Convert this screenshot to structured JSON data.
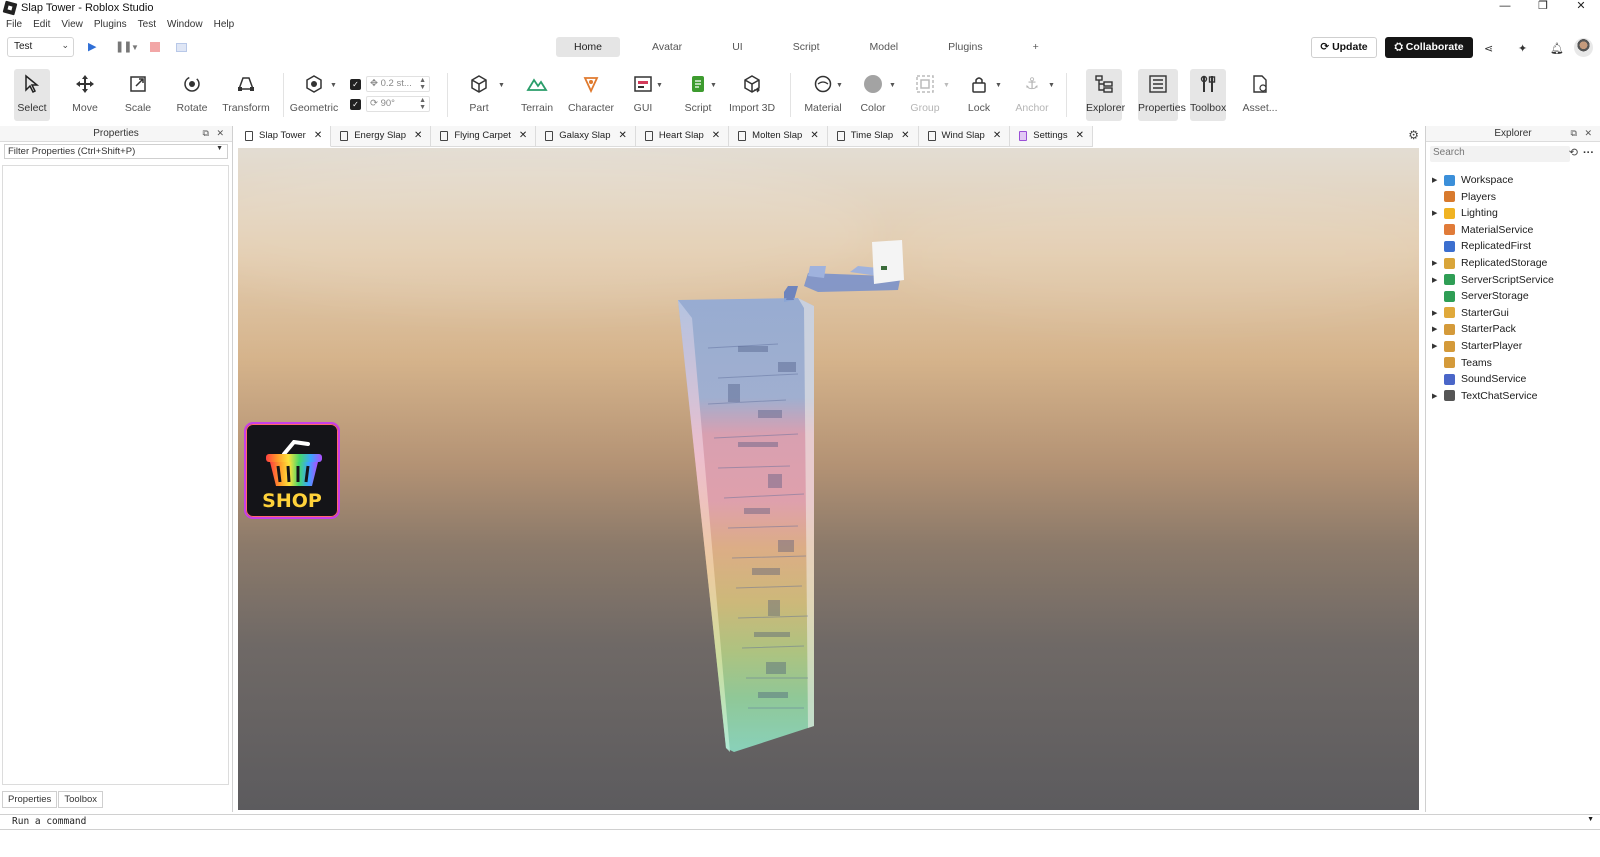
{
  "window": {
    "title": "Slap Tower - Roblox Studio",
    "controls": [
      "—",
      "❐",
      "✕"
    ]
  },
  "menu": [
    "File",
    "Edit",
    "View",
    "Plugins",
    "Test",
    "Window",
    "Help"
  ],
  "nav": {
    "mode_select": "Test",
    "tabs": [
      "Home",
      "Avatar",
      "UI",
      "Script",
      "Model",
      "Plugins",
      "+"
    ],
    "active_tab": "Home",
    "update_label": "Update",
    "collaborate_label": "Collaborate"
  },
  "ribbon": {
    "select": "Select",
    "move": "Move",
    "scale": "Scale",
    "rotate": "Rotate",
    "transform": "Transform",
    "geometric": "Geometric",
    "move_step": "0.2 st...",
    "rotate_step": "90°",
    "part": "Part",
    "terrain": "Terrain",
    "character": "Character",
    "gui": "GUI",
    "script": "Script",
    "import3d": "Import 3D",
    "material": "Material",
    "color": "Color",
    "group": "Group",
    "lock": "Lock",
    "anchor": "Anchor",
    "explorer": "Explorer",
    "properties": "Properties",
    "toolbox": "Toolbox",
    "asset": "Asset..."
  },
  "properties_panel": {
    "title": "Properties",
    "filter_placeholder": "Filter Properties (Ctrl+Shift+P)",
    "bottom_tabs": [
      "Properties",
      "Toolbox"
    ]
  },
  "doc_tabs": [
    "Slap Tower",
    "Energy Slap",
    "Flying Carpet",
    "Galaxy Slap",
    "Heart Slap",
    "Molten Slap",
    "Time Slap",
    "Wind Slap",
    "Settings"
  ],
  "viewport": {
    "shop_label": "SHOP"
  },
  "explorer": {
    "title": "Explorer",
    "search_placeholder": "Search",
    "items": [
      {
        "label": "Workspace",
        "expandable": true,
        "color": "#3b8fd9"
      },
      {
        "label": "Players",
        "expandable": false,
        "color": "#d87a2e"
      },
      {
        "label": "Lighting",
        "expandable": true,
        "color": "#f0b323"
      },
      {
        "label": "MaterialService",
        "expandable": false,
        "color": "#e07b39"
      },
      {
        "label": "ReplicatedFirst",
        "expandable": false,
        "color": "#3c6fcf"
      },
      {
        "label": "ReplicatedStorage",
        "expandable": true,
        "color": "#d9a53a"
      },
      {
        "label": "ServerScriptService",
        "expandable": true,
        "color": "#2f9e55"
      },
      {
        "label": "ServerStorage",
        "expandable": false,
        "color": "#2f9e55"
      },
      {
        "label": "StarterGui",
        "expandable": true,
        "color": "#e0a93b"
      },
      {
        "label": "StarterPack",
        "expandable": true,
        "color": "#d49a3a"
      },
      {
        "label": "StarterPlayer",
        "expandable": true,
        "color": "#d49a3a"
      },
      {
        "label": "Teams",
        "expandable": false,
        "color": "#d49a3a"
      },
      {
        "label": "SoundService",
        "expandable": false,
        "color": "#4a66c8"
      },
      {
        "label": "TextChatService",
        "expandable": true,
        "color": "#555555"
      }
    ]
  },
  "command_bar": {
    "placeholder": "Run a command"
  }
}
